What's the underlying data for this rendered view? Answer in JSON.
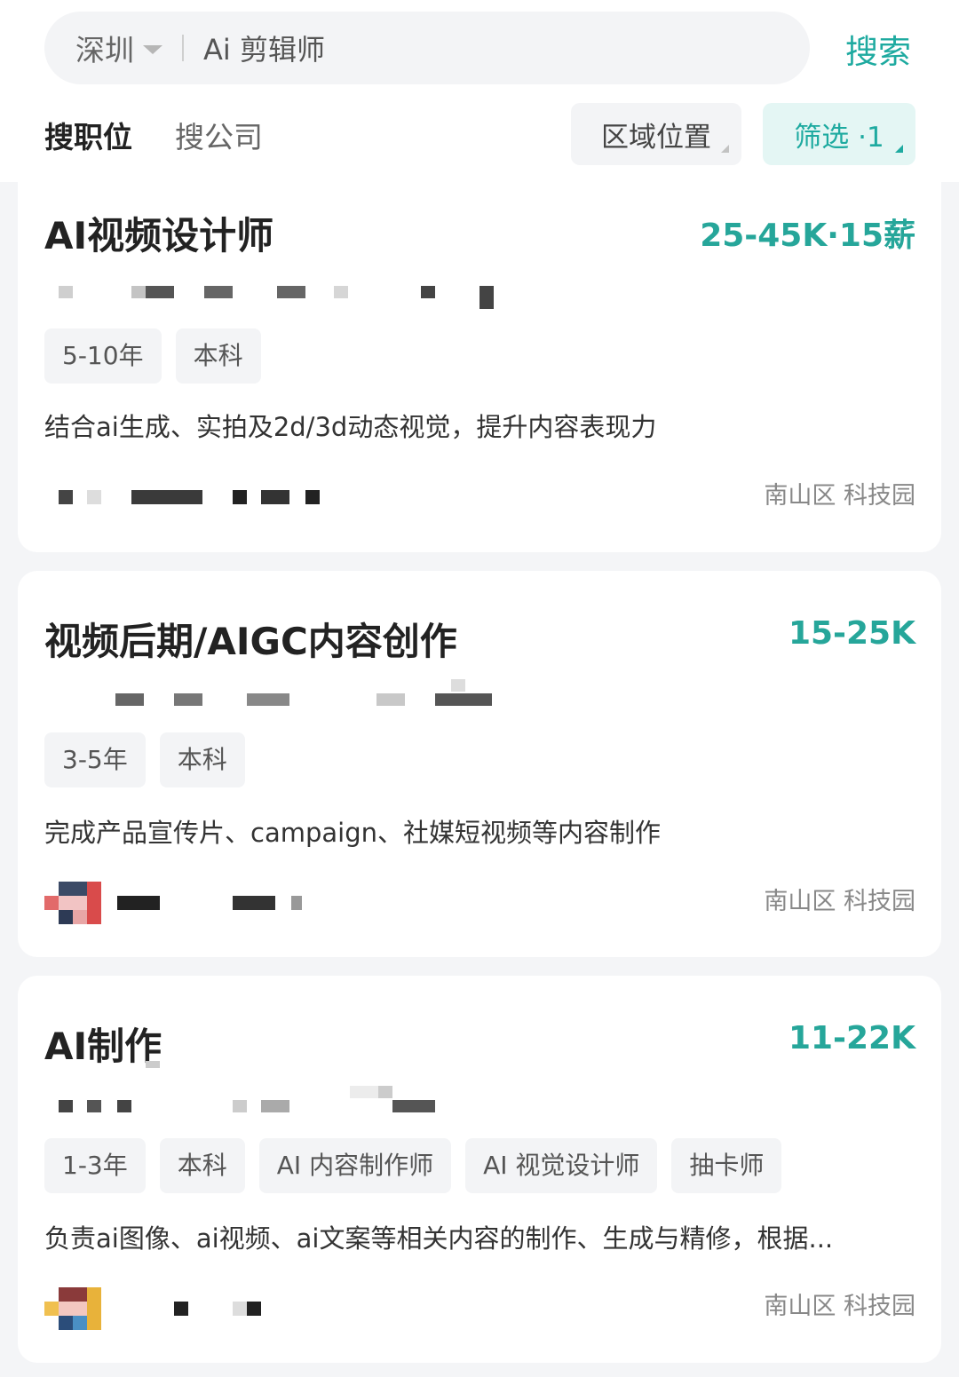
{
  "search": {
    "city": "深圳",
    "keyword": "Ai 剪辑师",
    "button_label": "搜索"
  },
  "tabs": {
    "jobs": "搜职位",
    "companies": "搜公司"
  },
  "filters": {
    "area_label": "区域位置",
    "filter_label": "筛选 ·1"
  },
  "colors": {
    "accent": "#26a69a",
    "accent_light": "#e4f6f4"
  },
  "jobs": [
    {
      "title": "AI视频设计师",
      "salary": "25-45K·15薪",
      "tags": [
        "5-10年",
        "本科"
      ],
      "description": "结合ai生成、实拍及2d/3d动态视觉，提升内容表现力",
      "location": "南山区  科技园"
    },
    {
      "title": "视频后期/AIGC内容创作",
      "salary": "15-25K",
      "tags": [
        "3-5年",
        "本科"
      ],
      "description": "完成产品宣传片、campaign、社媒短视频等内容制作",
      "location": "南山区  科技园"
    },
    {
      "title": "AI制作",
      "salary": "11-22K",
      "tags": [
        "1-3年",
        "本科",
        "AI 内容制作师",
        "AI 视觉设计师",
        "抽卡师"
      ],
      "description": "负责ai图像、ai视频、ai文案等相关内容的制作、生成与精修，根据...",
      "location": "南山区  科技园"
    }
  ]
}
